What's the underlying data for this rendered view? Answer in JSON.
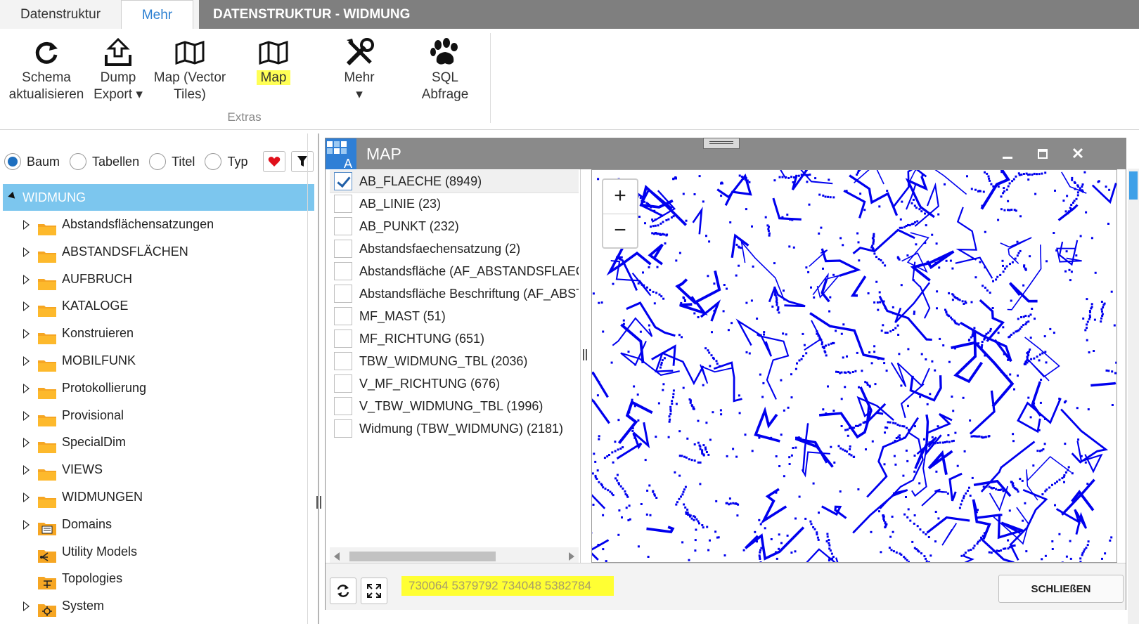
{
  "tabs": [
    {
      "label": "Datenstruktur",
      "active": false
    },
    {
      "label": "Mehr",
      "active": true
    }
  ],
  "document_title": "DATENSTRUKTUR - WIDMUNG",
  "ribbon": {
    "buttons": [
      {
        "label": "Schema\naktualisieren",
        "icon": "refresh-icon"
      },
      {
        "label": "Dump\nExport ▾",
        "icon": "upload-icon"
      },
      {
        "label": "Map (Vector\nTiles)",
        "icon": "map-book-icon"
      },
      {
        "label": "Map",
        "icon": "map-book-icon",
        "highlighted": true
      },
      {
        "label": "Mehr\n▾",
        "icon": "tools-icon"
      },
      {
        "label": "SQL\nAbfrage",
        "icon": "paw-icon"
      }
    ],
    "group_label": "Extras"
  },
  "view_options": {
    "radios": [
      {
        "label": "Baum",
        "checked": true
      },
      {
        "label": "Tabellen",
        "checked": false
      },
      {
        "label": "Titel",
        "checked": false
      },
      {
        "label": "Typ",
        "checked": false
      }
    ],
    "favorite_icon": "heart-icon",
    "filter_icon": "filter-icon"
  },
  "tree": {
    "root": "WIDMUNG",
    "items": [
      {
        "label": "Abstandsflächensatzungen",
        "icon": "folder-icon",
        "expandable": true
      },
      {
        "label": "ABSTANDSFLÄCHEN",
        "icon": "folder-icon",
        "expandable": true
      },
      {
        "label": "AUFBRUCH",
        "icon": "folder-icon",
        "expandable": true
      },
      {
        "label": "KATALOGE",
        "icon": "folder-icon",
        "expandable": true
      },
      {
        "label": "Konstruieren",
        "icon": "folder-icon",
        "expandable": true
      },
      {
        "label": "MOBILFUNK",
        "icon": "folder-icon",
        "expandable": true
      },
      {
        "label": "Protokollierung",
        "icon": "folder-icon",
        "expandable": true
      },
      {
        "label": "Provisional",
        "icon": "folder-icon",
        "expandable": true
      },
      {
        "label": "SpecialDim",
        "icon": "folder-icon",
        "expandable": true
      },
      {
        "label": "VIEWS",
        "icon": "folder-icon",
        "expandable": true
      },
      {
        "label": "WIDMUNGEN",
        "icon": "folder-icon",
        "expandable": true
      },
      {
        "label": "Domains",
        "icon": "domains-folder-icon",
        "expandable": true
      },
      {
        "label": "Utility Models",
        "icon": "utility-models-icon",
        "expandable": false
      },
      {
        "label": "Topologies",
        "icon": "topology-icon",
        "expandable": false
      },
      {
        "label": "System",
        "icon": "system-folder-icon",
        "expandable": true
      }
    ]
  },
  "map_window": {
    "title": "MAP",
    "app_icon": "app-logo-icon",
    "layers": [
      {
        "label": "AB_FLAECHE (8949)",
        "checked": true
      },
      {
        "label": "AB_LINIE (23)",
        "checked": false
      },
      {
        "label": "AB_PUNKT (232)",
        "checked": false
      },
      {
        "label": "Abstandsfaechensatzung (2)",
        "checked": false
      },
      {
        "label": "Abstandsfläche (AF_ABSTANDSFLAECHE)",
        "checked": false
      },
      {
        "label": "Abstandsfläche Beschriftung (AF_ABSTAN",
        "checked": false
      },
      {
        "label": "MF_MAST (51)",
        "checked": false
      },
      {
        "label": "MF_RICHTUNG (651)",
        "checked": false
      },
      {
        "label": "TBW_WIDMUNG_TBL (2036)",
        "checked": false
      },
      {
        "label": "V_MF_RICHTUNG (676)",
        "checked": false
      },
      {
        "label": "V_TBW_WIDMUNG_TBL (1996)",
        "checked": false
      },
      {
        "label": "Widmung (TBW_WIDMUNG) (2181)",
        "checked": false
      }
    ],
    "zoom_in": "+",
    "zoom_out": "−",
    "extent": "730064 5379792 734048 5382784",
    "close_label": "SCHLIEßEN",
    "map_feature_color": "#0000ee",
    "highlight_color": "#ffff33"
  }
}
